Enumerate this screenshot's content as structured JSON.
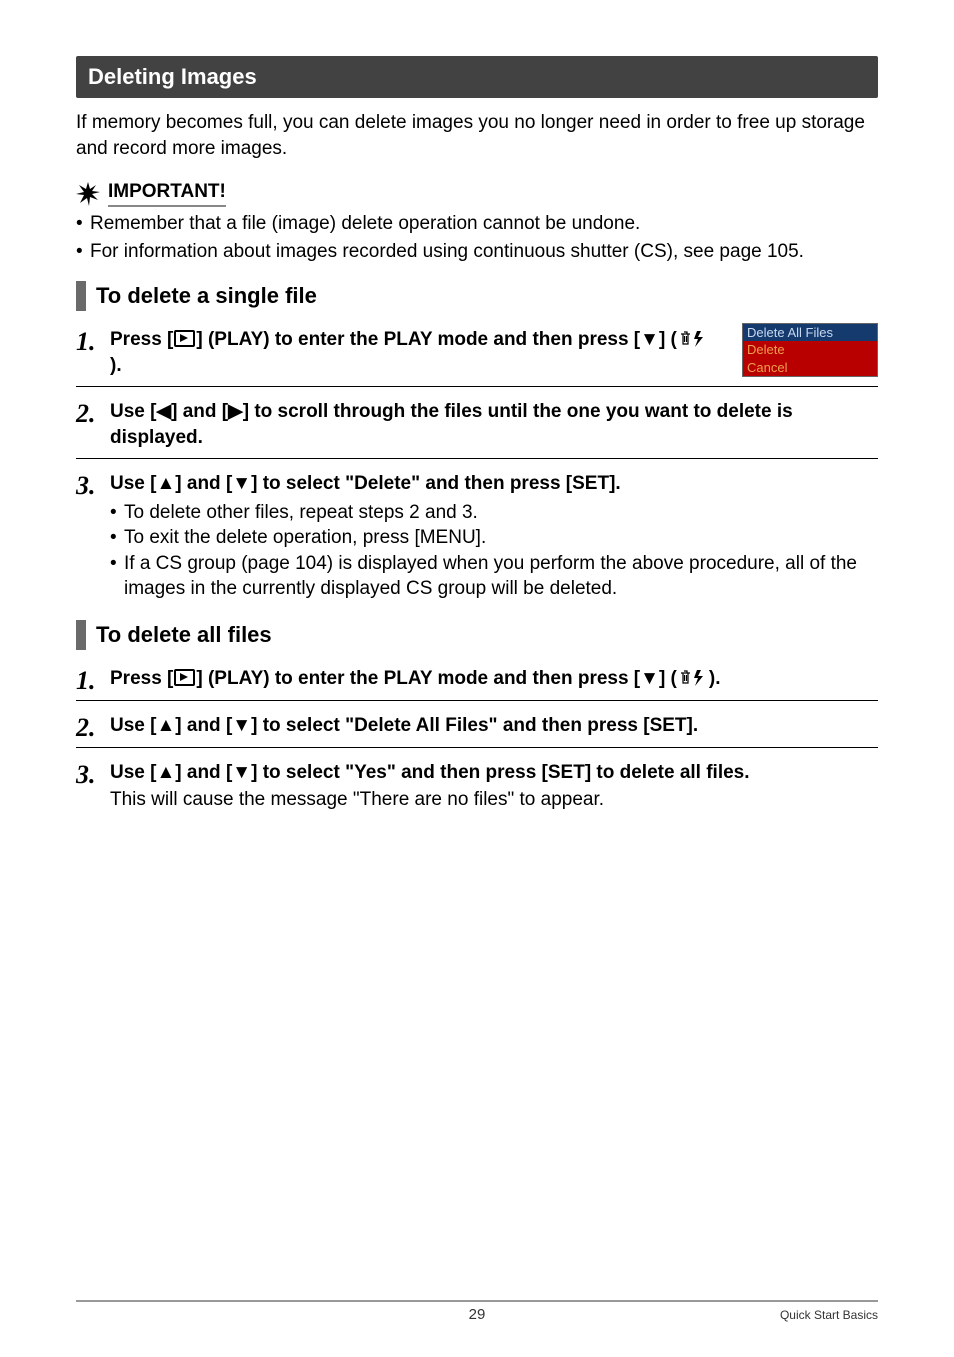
{
  "section_title": "Deleting Images",
  "intro": "If memory becomes full, you can delete images you no longer need in order to free up storage and record more images.",
  "important_label": "IMPORTANT!",
  "important_bullets": [
    "Remember that a file (image) delete operation cannot be undone.",
    "For information about images recorded using continuous shutter (CS), see page 105."
  ],
  "subsection1": "To delete a single file",
  "s1_step1_a": "Press [",
  "s1_step1_b": "] (PLAY) to enter the PLAY mode and then press [",
  "s1_step1_c": "] (",
  "s1_step1_d": ").",
  "menu": {
    "selected": "Delete All Files",
    "opt1": "Delete",
    "opt2": "Cancel"
  },
  "s1_step2_a": "Use [",
  "s1_step2_b": "] and [",
  "s1_step2_c": "] to scroll through the files until the one you want to delete is displayed.",
  "s1_step3_a": "Use [",
  "s1_step3_b": "] and [",
  "s1_step3_c": "] to select \"Delete\" and then press [SET].",
  "s1_step3_bullets": [
    "To delete other files, repeat steps 2 and 3.",
    "To exit the delete operation, press [MENU].",
    "If a CS group (page 104) is displayed when you perform the above procedure, all of the images in the currently displayed CS group will be deleted."
  ],
  "subsection2": "To delete all files",
  "s2_step1_a": "Press [",
  "s2_step1_b": "] (PLAY) to enter the PLAY mode and then press [",
  "s2_step1_c": "] (",
  "s2_step1_d": ").",
  "s2_step2_a": "Use [",
  "s2_step2_b": "] and [",
  "s2_step2_c": "] to select \"Delete All Files\" and then press [SET].",
  "s2_step3_a": "Use [",
  "s2_step3_b": "] and [",
  "s2_step3_c": "] to select \"Yes\" and then press [SET] to delete all files.",
  "s2_step3_sub": "This will cause the message \"There are no files\" to appear.",
  "nums": {
    "n1": "1.",
    "n2": "2.",
    "n3": "3."
  },
  "footer": {
    "page": "29",
    "crumb": "Quick Start Basics"
  },
  "arrows": {
    "left": "◀",
    "right": "▶",
    "up": "▲",
    "down": "▼"
  }
}
